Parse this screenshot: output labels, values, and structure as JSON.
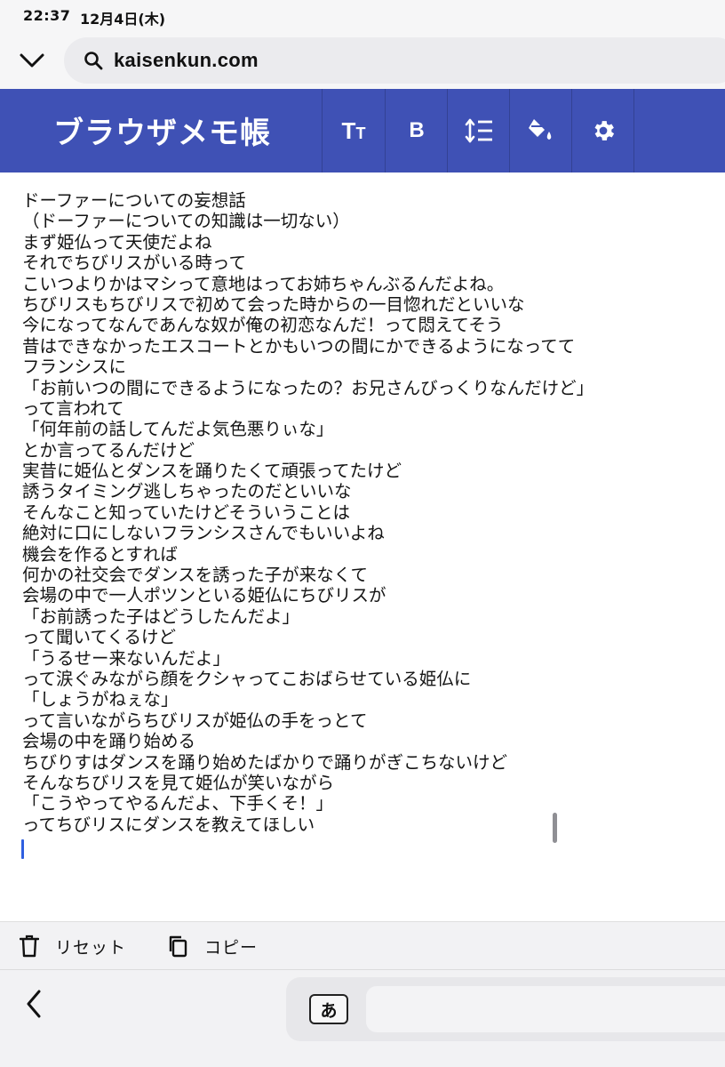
{
  "status_bar": {
    "time": "22:37",
    "date": "12月4日(木)"
  },
  "browser": {
    "url": "kaisenkun.com",
    "icons": {
      "collapse": "chevron-down-icon",
      "search": "search-icon"
    }
  },
  "app": {
    "title": "ブラウザメモ帳",
    "toolbar_color": "#3f51b5",
    "toolbar": {
      "text_size_big": "T",
      "text_size_small": "T",
      "bold_label": "B",
      "icons": [
        "text-size-icon",
        "bold-icon",
        "line-height-icon",
        "paint-bucket-icon",
        "gear-icon"
      ]
    }
  },
  "memo": {
    "lines": [
      "ドーファーについての妄想話",
      "（ドーファーについての知識は一切ない）",
      "まず姫仏って天使だよね",
      "それでちびリスがいる時って",
      "こいつよりかはマシって意地はってお姉ちゃんぶるんだよね。",
      "ちびリスもちびリスで初めて会った時からの一目惚れだといいな",
      "今になってなんであんな奴が俺の初恋なんだ！って悶えてそう",
      "昔はできなかったエスコートとかもいつの間にかできるようになってて",
      "フランシスに",
      "「お前いつの間にできるようになったの？お兄さんびっくりなんだけど」",
      "って言われて",
      "「何年前の話してんだよ気色悪りぃな」",
      "とか言ってるんだけど",
      "実昔に姫仏とダンスを踊りたくて頑張ってたけど",
      "誘うタイミング逃しちゃったのだといいな",
      "そんなこと知っていたけどそういうことは",
      "絶対に口にしないフランシスさんでもいいよね",
      "機会を作るとすれば",
      "何かの社交会でダンスを誘った子が来なくて",
      "会場の中で一人ポツンといる姫仏にちびリスが",
      "「お前誘った子はどうしたんだよ」",
      "って聞いてくるけど",
      "「うるせー来ないんだよ」",
      "って涙ぐみながら顔をクシャってこおばらせている姫仏に",
      "「しょうがねぇな」",
      "って言いながらちびリスが姫仏の手をっとて",
      "会場の中を踊り始める",
      "ちびりすはダンスを踊り始めたばかりで踊りがぎこちないけど",
      "そんなちびリスを見て姫仏が笑いながら",
      "「こうやってやるんだよ、下手くそ！」",
      "ってちびリスにダンスを教えてほしい"
    ]
  },
  "actions": {
    "reset_label": "リセット",
    "copy_label": "コピー",
    "icons": {
      "reset": "trash-icon",
      "copy": "copy-icon"
    }
  },
  "keyboard": {
    "input_mode_key": "あ",
    "icons": {
      "back": "chevron-left-icon"
    }
  }
}
